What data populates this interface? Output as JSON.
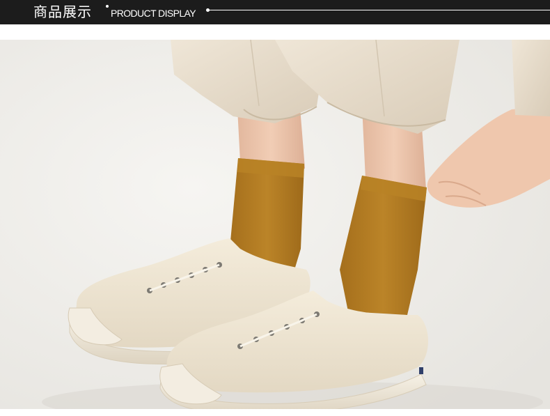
{
  "header": {
    "title_cn": "商品展示",
    "title_en": "PRODUCT DISPLAY"
  },
  "colors": {
    "header_background": "#1c1c1c",
    "header_text": "#ffffff",
    "sock_color": "#b07a22",
    "shoe_color": "#efe6d3",
    "pants_color": "#e7dccb",
    "backdrop": "#eeedea"
  }
}
